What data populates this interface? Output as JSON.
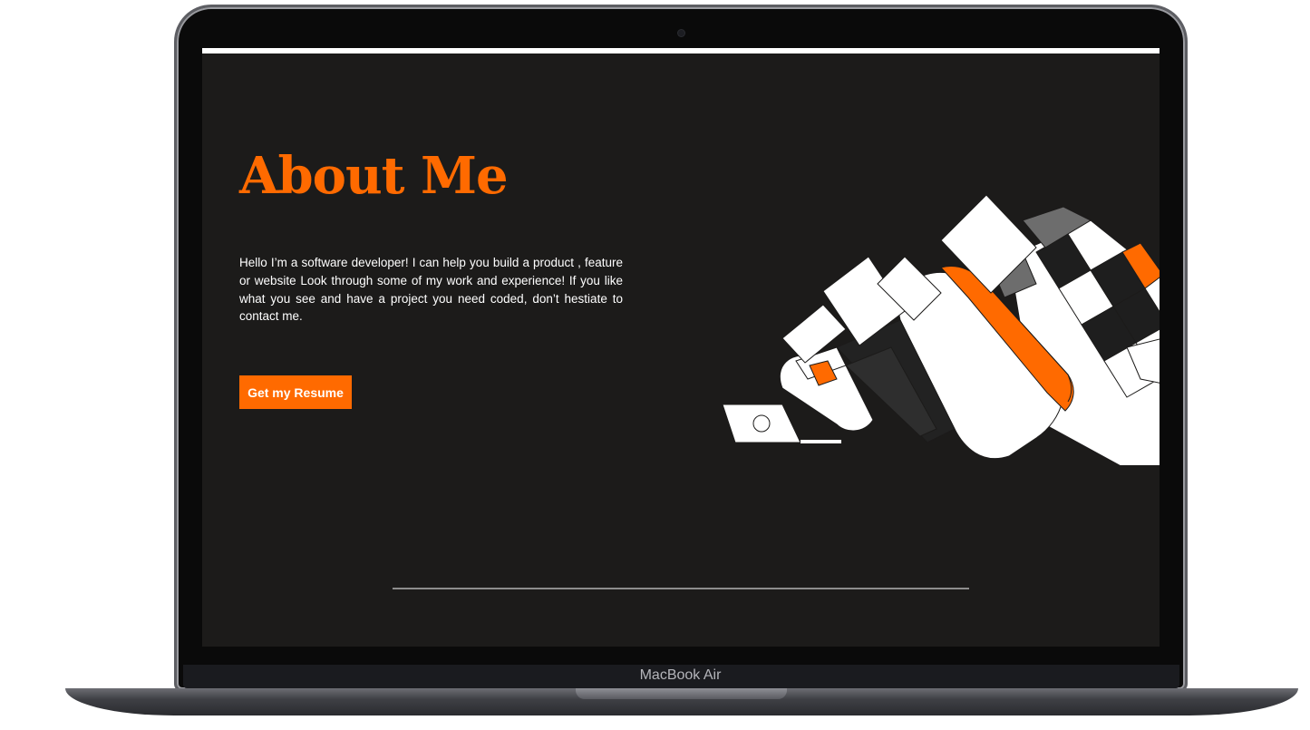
{
  "about": {
    "heading": "About Me",
    "bio": "Hello I’m a software developer! I can help you build a product , feature or website Look through some of my work and experience! If you like what you see and have a project you need coded, don’t hestiate to contact me.",
    "resume_button": "Get my Resume"
  },
  "device": {
    "label": "MacBook Air"
  },
  "colors": {
    "accent": "#ff6a00",
    "screen_background": "#1c1b1a",
    "text": "#ffffff"
  }
}
